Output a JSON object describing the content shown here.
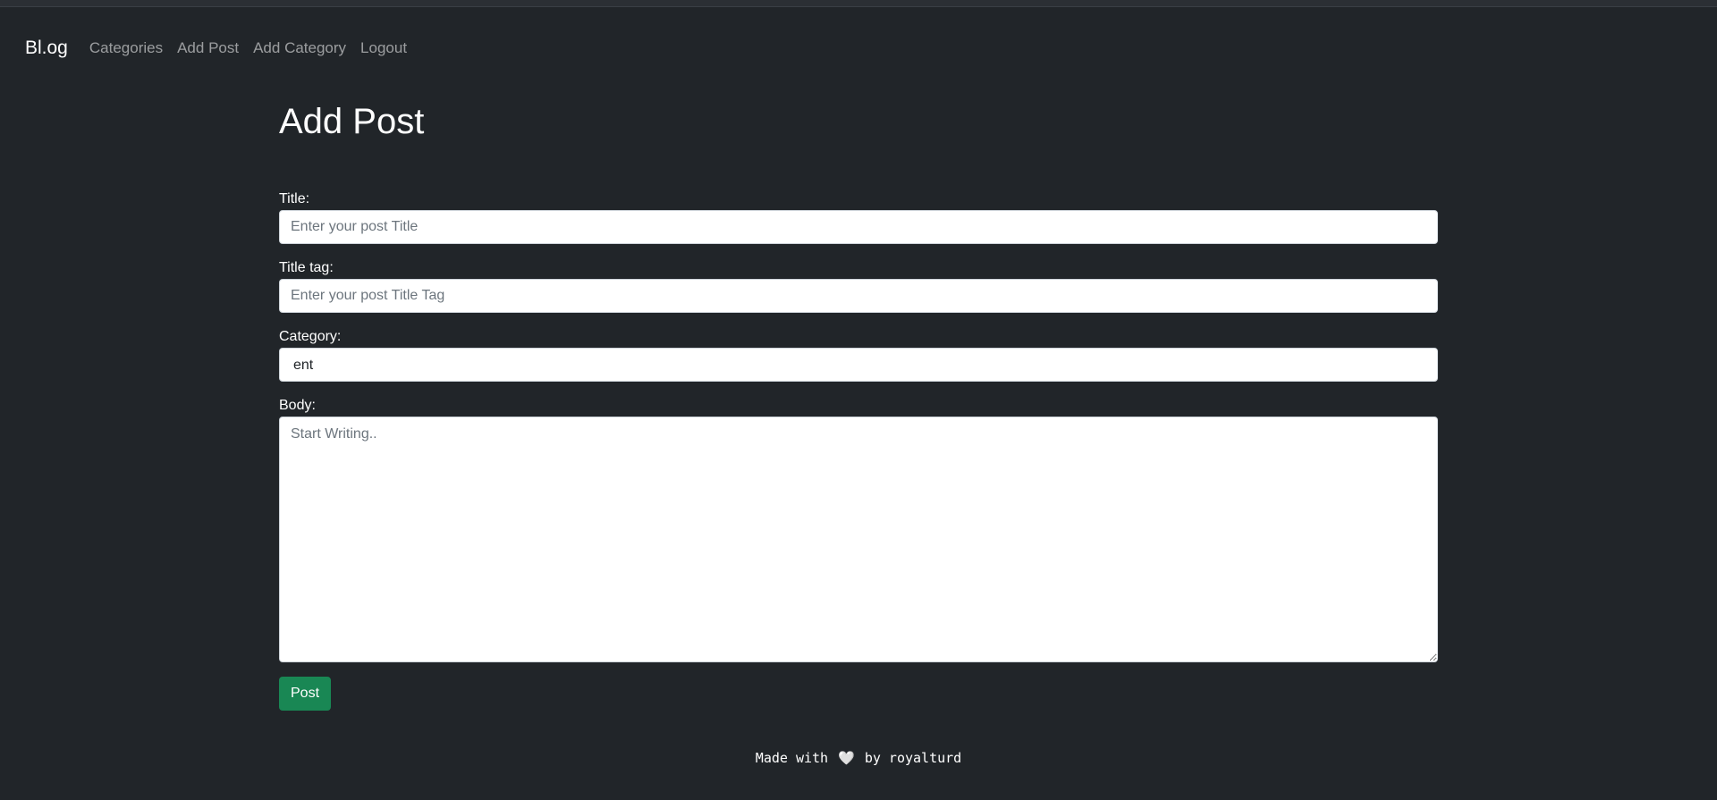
{
  "nav": {
    "brand": "Bl.og",
    "links": [
      "Categories",
      "Add Post",
      "Add Category",
      "Logout"
    ]
  },
  "page": {
    "title": "Add Post"
  },
  "form": {
    "title": {
      "label": "Title:",
      "placeholder": "Enter your post Title",
      "value": ""
    },
    "title_tag": {
      "label": "Title tag:",
      "placeholder": "Enter your post Title Tag",
      "value": ""
    },
    "category": {
      "label": "Category:",
      "selected": "ent"
    },
    "body": {
      "label": "Body:",
      "placeholder": "Start Writing..",
      "value": ""
    },
    "submit_label": "Post"
  },
  "footer": {
    "prefix": "Made with",
    "heart_icon": "heart-icon",
    "suffix": "by royalturd"
  },
  "colors": {
    "background": "#212529",
    "button": "#198754"
  }
}
